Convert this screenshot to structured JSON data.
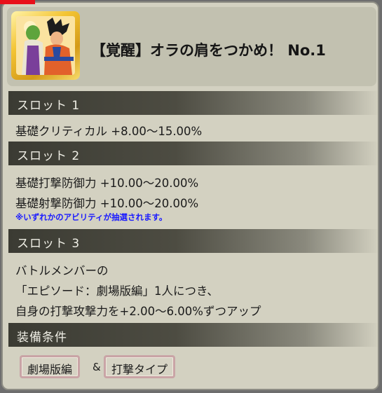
{
  "header": {
    "title": "【覚醒】オラの肩をつかめ！ No.1",
    "thumbnail": "character-card-icon"
  },
  "slots": [
    {
      "label": "スロット 1",
      "lines": [
        "基礎クリティカル +8.00〜15.00%"
      ],
      "note": ""
    },
    {
      "label": "スロット 2",
      "lines": [
        "基礎打撃防御力 +10.00〜20.00%",
        "基礎射撃防御力 +10.00〜20.00%"
      ],
      "note": "※いずれかのアビリティが抽選されます。"
    },
    {
      "label": "スロット 3",
      "lines": [
        "バトルメンバーの",
        "「エピソード：劇場版編」1人につき、",
        "自身の打撃攻撃力を+2.00〜6.00%ずつアップ"
      ],
      "note": ""
    }
  ],
  "equip": {
    "label": "装備条件",
    "tags": [
      "劇場版編",
      "打撃タイプ"
    ],
    "joiner": "&"
  },
  "colors": {
    "panel": "#d3d1c1",
    "section_bar": "#3b3b33",
    "note": "#1a1aff",
    "tag_border": "#c9a4a6",
    "card_frame": "#f3c433"
  }
}
